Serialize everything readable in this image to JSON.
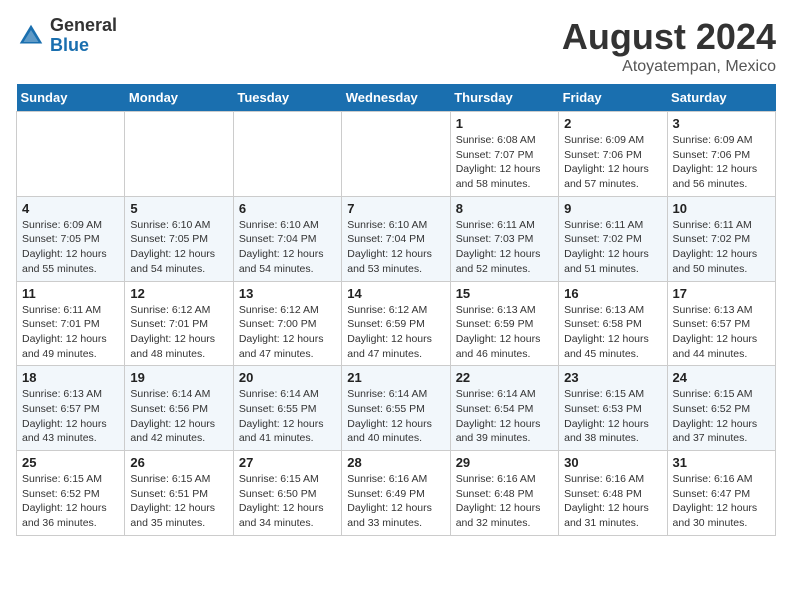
{
  "header": {
    "logo_general": "General",
    "logo_blue": "Blue",
    "month_year": "August 2024",
    "location": "Atoyatempan, Mexico"
  },
  "weekdays": [
    "Sunday",
    "Monday",
    "Tuesday",
    "Wednesday",
    "Thursday",
    "Friday",
    "Saturday"
  ],
  "weeks": [
    [
      {
        "day": "",
        "info": ""
      },
      {
        "day": "",
        "info": ""
      },
      {
        "day": "",
        "info": ""
      },
      {
        "day": "",
        "info": ""
      },
      {
        "day": "1",
        "info": "Sunrise: 6:08 AM\nSunset: 7:07 PM\nDaylight: 12 hours\nand 58 minutes."
      },
      {
        "day": "2",
        "info": "Sunrise: 6:09 AM\nSunset: 7:06 PM\nDaylight: 12 hours\nand 57 minutes."
      },
      {
        "day": "3",
        "info": "Sunrise: 6:09 AM\nSunset: 7:06 PM\nDaylight: 12 hours\nand 56 minutes."
      }
    ],
    [
      {
        "day": "4",
        "info": "Sunrise: 6:09 AM\nSunset: 7:05 PM\nDaylight: 12 hours\nand 55 minutes."
      },
      {
        "day": "5",
        "info": "Sunrise: 6:10 AM\nSunset: 7:05 PM\nDaylight: 12 hours\nand 54 minutes."
      },
      {
        "day": "6",
        "info": "Sunrise: 6:10 AM\nSunset: 7:04 PM\nDaylight: 12 hours\nand 54 minutes."
      },
      {
        "day": "7",
        "info": "Sunrise: 6:10 AM\nSunset: 7:04 PM\nDaylight: 12 hours\nand 53 minutes."
      },
      {
        "day": "8",
        "info": "Sunrise: 6:11 AM\nSunset: 7:03 PM\nDaylight: 12 hours\nand 52 minutes."
      },
      {
        "day": "9",
        "info": "Sunrise: 6:11 AM\nSunset: 7:02 PM\nDaylight: 12 hours\nand 51 minutes."
      },
      {
        "day": "10",
        "info": "Sunrise: 6:11 AM\nSunset: 7:02 PM\nDaylight: 12 hours\nand 50 minutes."
      }
    ],
    [
      {
        "day": "11",
        "info": "Sunrise: 6:11 AM\nSunset: 7:01 PM\nDaylight: 12 hours\nand 49 minutes."
      },
      {
        "day": "12",
        "info": "Sunrise: 6:12 AM\nSunset: 7:01 PM\nDaylight: 12 hours\nand 48 minutes."
      },
      {
        "day": "13",
        "info": "Sunrise: 6:12 AM\nSunset: 7:00 PM\nDaylight: 12 hours\nand 47 minutes."
      },
      {
        "day": "14",
        "info": "Sunrise: 6:12 AM\nSunset: 6:59 PM\nDaylight: 12 hours\nand 47 minutes."
      },
      {
        "day": "15",
        "info": "Sunrise: 6:13 AM\nSunset: 6:59 PM\nDaylight: 12 hours\nand 46 minutes."
      },
      {
        "day": "16",
        "info": "Sunrise: 6:13 AM\nSunset: 6:58 PM\nDaylight: 12 hours\nand 45 minutes."
      },
      {
        "day": "17",
        "info": "Sunrise: 6:13 AM\nSunset: 6:57 PM\nDaylight: 12 hours\nand 44 minutes."
      }
    ],
    [
      {
        "day": "18",
        "info": "Sunrise: 6:13 AM\nSunset: 6:57 PM\nDaylight: 12 hours\nand 43 minutes."
      },
      {
        "day": "19",
        "info": "Sunrise: 6:14 AM\nSunset: 6:56 PM\nDaylight: 12 hours\nand 42 minutes."
      },
      {
        "day": "20",
        "info": "Sunrise: 6:14 AM\nSunset: 6:55 PM\nDaylight: 12 hours\nand 41 minutes."
      },
      {
        "day": "21",
        "info": "Sunrise: 6:14 AM\nSunset: 6:55 PM\nDaylight: 12 hours\nand 40 minutes."
      },
      {
        "day": "22",
        "info": "Sunrise: 6:14 AM\nSunset: 6:54 PM\nDaylight: 12 hours\nand 39 minutes."
      },
      {
        "day": "23",
        "info": "Sunrise: 6:15 AM\nSunset: 6:53 PM\nDaylight: 12 hours\nand 38 minutes."
      },
      {
        "day": "24",
        "info": "Sunrise: 6:15 AM\nSunset: 6:52 PM\nDaylight: 12 hours\nand 37 minutes."
      }
    ],
    [
      {
        "day": "25",
        "info": "Sunrise: 6:15 AM\nSunset: 6:52 PM\nDaylight: 12 hours\nand 36 minutes."
      },
      {
        "day": "26",
        "info": "Sunrise: 6:15 AM\nSunset: 6:51 PM\nDaylight: 12 hours\nand 35 minutes."
      },
      {
        "day": "27",
        "info": "Sunrise: 6:15 AM\nSunset: 6:50 PM\nDaylight: 12 hours\nand 34 minutes."
      },
      {
        "day": "28",
        "info": "Sunrise: 6:16 AM\nSunset: 6:49 PM\nDaylight: 12 hours\nand 33 minutes."
      },
      {
        "day": "29",
        "info": "Sunrise: 6:16 AM\nSunset: 6:48 PM\nDaylight: 12 hours\nand 32 minutes."
      },
      {
        "day": "30",
        "info": "Sunrise: 6:16 AM\nSunset: 6:48 PM\nDaylight: 12 hours\nand 31 minutes."
      },
      {
        "day": "31",
        "info": "Sunrise: 6:16 AM\nSunset: 6:47 PM\nDaylight: 12 hours\nand 30 minutes."
      }
    ]
  ]
}
